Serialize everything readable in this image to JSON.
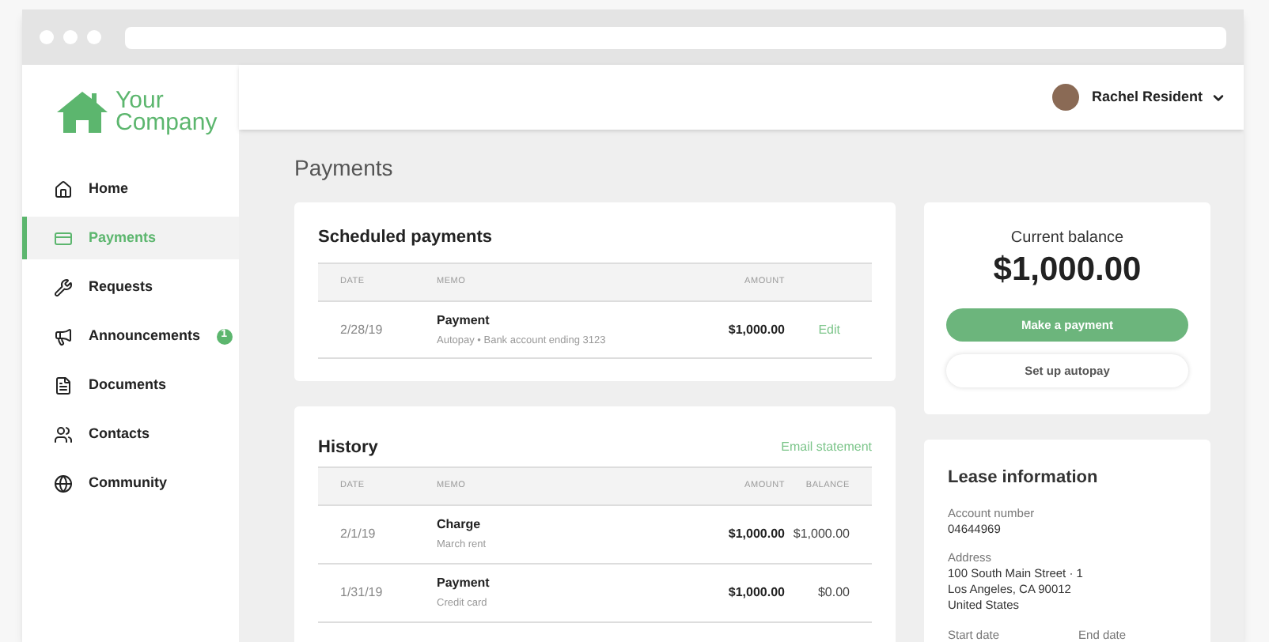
{
  "brand": {
    "line_1": "Your",
    "line_2": "Company"
  },
  "sidebar": {
    "items": [
      {
        "label": "Home",
        "selected": false
      },
      {
        "label": "Payments",
        "selected": true
      },
      {
        "label": "Requests",
        "selected": false
      },
      {
        "label": "Announcements",
        "selected": false,
        "badge": "1"
      },
      {
        "label": "Documents",
        "selected": false
      },
      {
        "label": "Contacts",
        "selected": false
      },
      {
        "label": "Community",
        "selected": false
      }
    ]
  },
  "header": {
    "user": "Rachel Resident"
  },
  "page_title": "Payments",
  "scheduled": {
    "title": "Scheduled payments",
    "columns": [
      "DATE",
      "MEMO",
      "AMOUNT"
    ],
    "rows": [
      {
        "date": "2/28/19",
        "memo": "Payment",
        "detail": "Autopay • Bank account ending 3123",
        "amount": "$1,000.00",
        "action": "Edit"
      }
    ]
  },
  "history": {
    "title": "History",
    "link": "Email statement",
    "columns": [
      "DATE",
      "MEMO",
      "AMOUNT",
      "BALANCE"
    ],
    "rows": [
      {
        "date": "2/1/19",
        "memo": "Charge",
        "detail": "March rent",
        "amount": "$1,000.00",
        "balance": "$1,000.00"
      },
      {
        "date": "1/31/19",
        "memo": "Payment",
        "detail": "Credit card",
        "amount": "$1,000.00",
        "balance": "$0.00"
      }
    ]
  },
  "balance": {
    "label": "Current balance",
    "amount": "$1,000.00",
    "primary_button": "Make a payment",
    "secondary_button": "Set up autopay"
  },
  "lease": {
    "title": "Lease information",
    "fields": [
      {
        "label": "Account number",
        "value": "04644969"
      },
      {
        "label": "Address",
        "lines": [
          "100 South Main Street · 1",
          "Los Angeles, CA 90012",
          "United States"
        ]
      }
    ],
    "columns": [
      "Start date",
      "End date"
    ]
  }
}
